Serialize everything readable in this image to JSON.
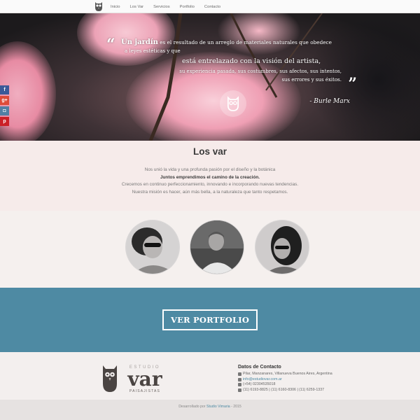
{
  "nav": {
    "items": [
      "Inicio",
      "Los Var",
      "Servicios",
      "Portfolio",
      "Contacto"
    ]
  },
  "hero": {
    "quote_word": "Un jardín",
    "quote_line1": "es el resultado de un arreglo de materiales naturales que obedece",
    "quote_line2": "a leyes estéticas y que",
    "quote_line3": "está entrelazado con la visión del artista,",
    "quote_line4": "su experiencia pasada, sus costumbres, sus afectos, sus intentos,",
    "quote_line5": "sus errores y sus éxitos.",
    "author": "- Burle Marx"
  },
  "social": [
    {
      "icon": "facebook-icon",
      "glyph": "f",
      "color": "#3b5998"
    },
    {
      "icon": "google-plus-icon",
      "glyph": "g+",
      "color": "#dd4b39"
    },
    {
      "icon": "instagram-icon",
      "glyph": "◘",
      "color": "#517fa4"
    },
    {
      "icon": "pinterest-icon",
      "glyph": "p",
      "color": "#cb2027"
    }
  ],
  "about": {
    "title": "Los var",
    "line1": "Nos unió la vida y una profunda pasión por el diseño y la botánica",
    "line2": "Juntos emprendimos el camino de la creación.",
    "line3": "Crecemos en continuo perfeccionamiento, innovando e incorporando nuevas tendencias.",
    "line4": "Nuestra misión es hacer, aún más bella, a la naturaleza que tanto respetamos."
  },
  "portfolio": {
    "button_label": "VER PORTFOLIO"
  },
  "footer": {
    "logo_top": "ESTUDIO",
    "logo_main": "var",
    "logo_bottom": "PAISAJISTAS",
    "contact_title": "Datos de Contacto",
    "address": "Pilar, Manzanares, Villanueva Buenos Aires, Argentina",
    "email": "info@estudiovar.com.ar",
    "phone": "(+54) 02304535018",
    "mobile": "(11) 6193-8825 | (11) 6160-8306 | (11) 6259-1337"
  },
  "copyright": {
    "prefix": "Desarrollado por",
    "link": "Studio Vimaria",
    "suffix": "- 2015"
  },
  "colors": {
    "accent_blue": "#4e8aa3",
    "about_bg": "#f6ebea"
  }
}
